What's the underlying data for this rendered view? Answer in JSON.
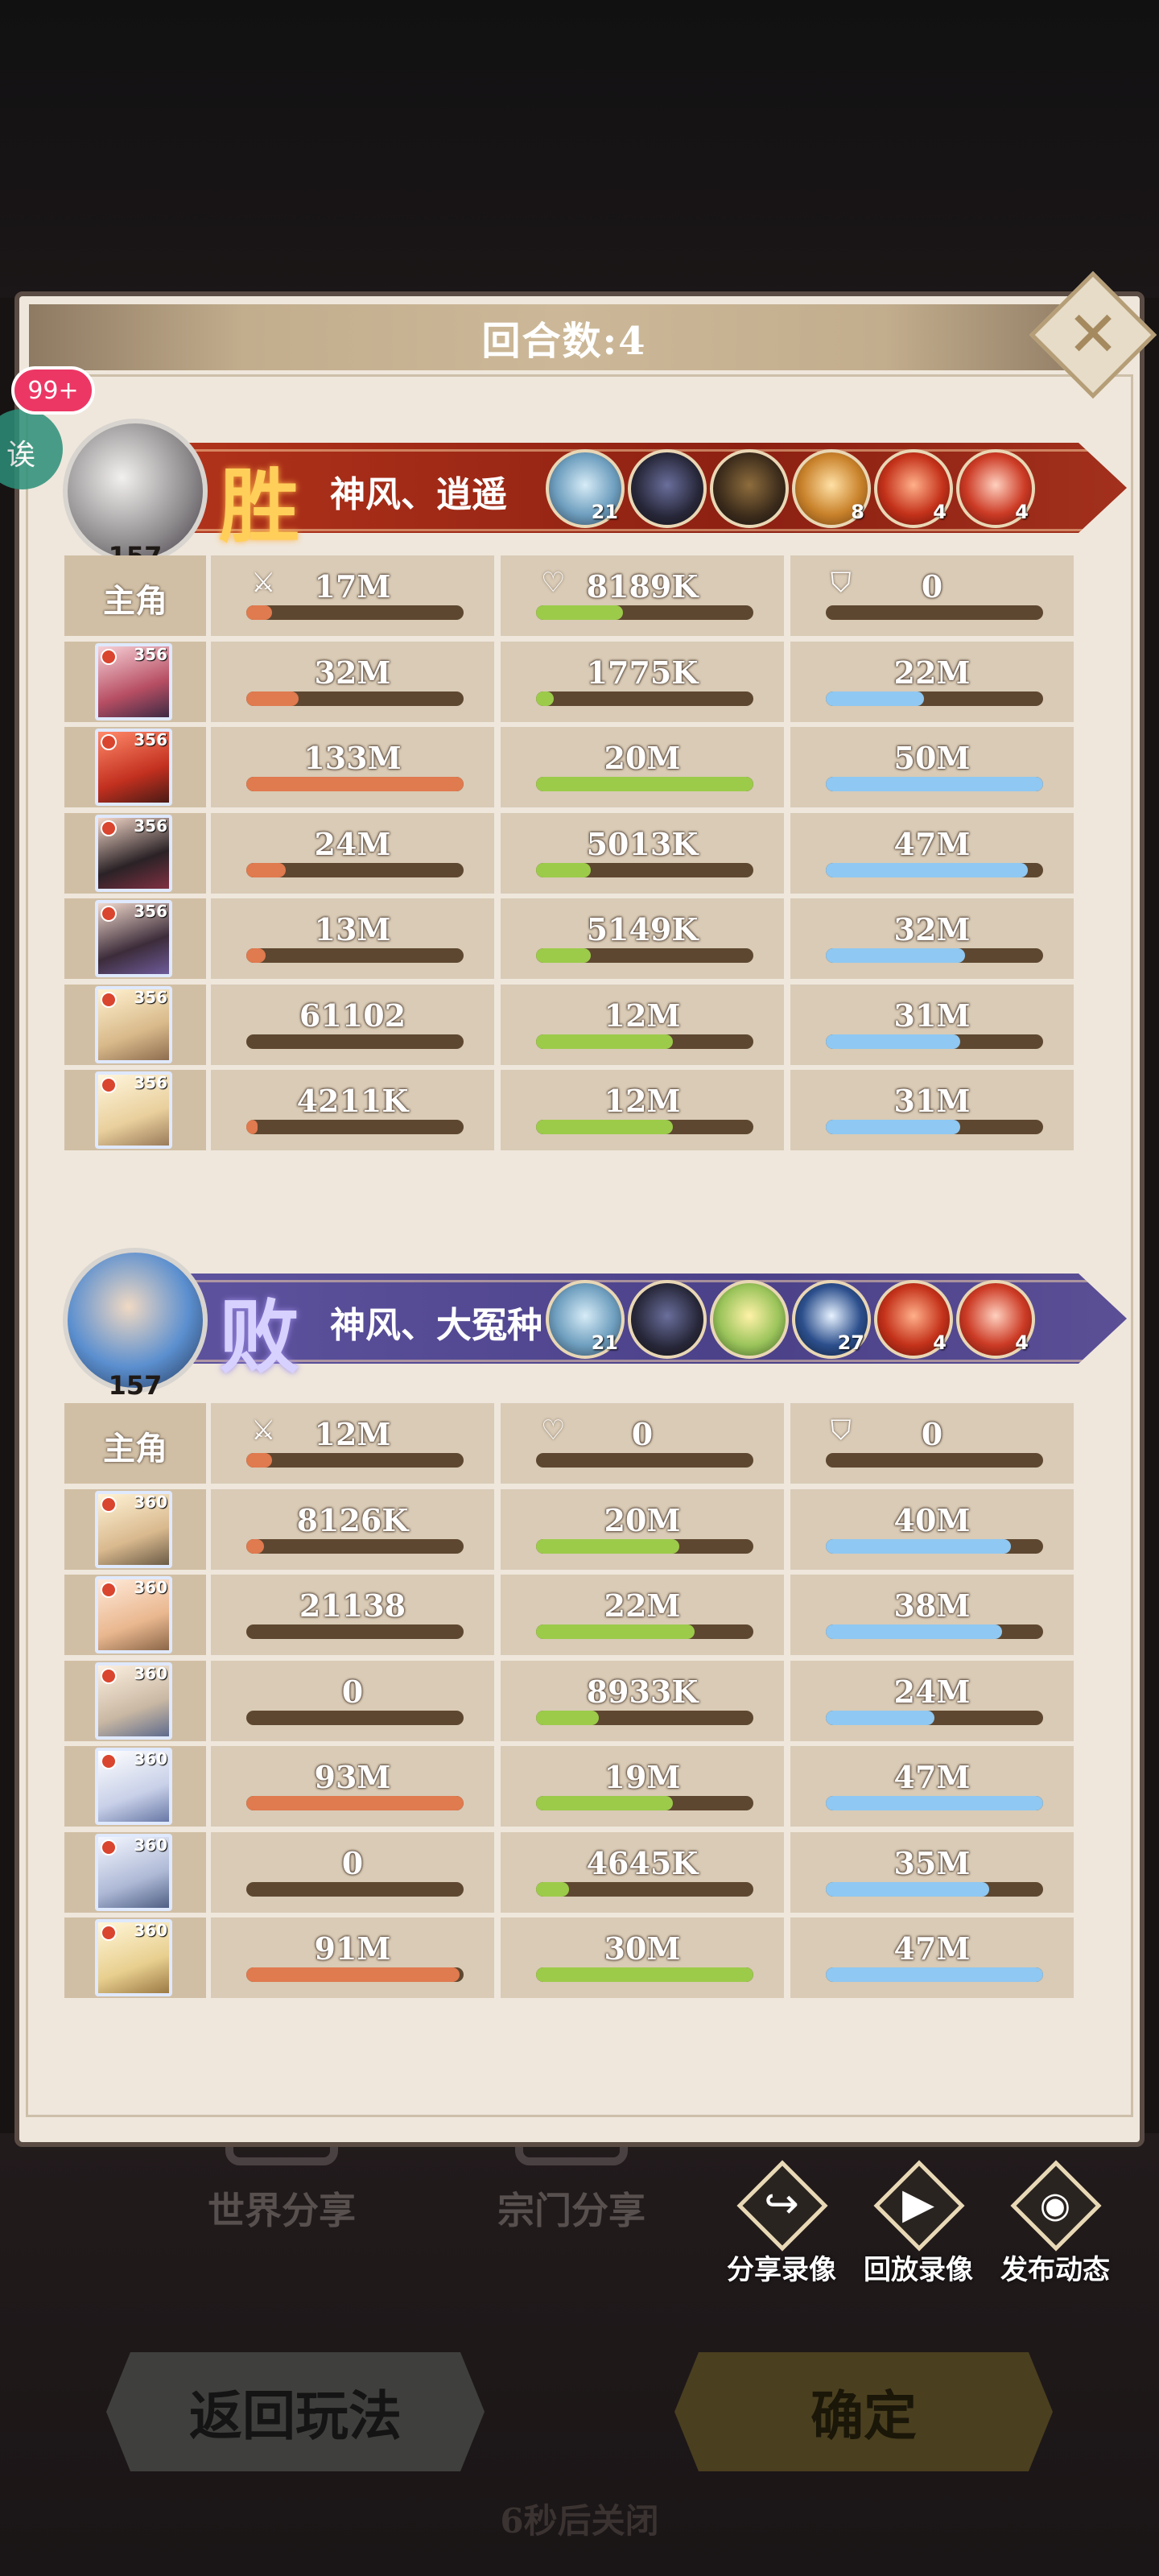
{
  "title": "回合数:4",
  "notification_badge": "99+",
  "side_bubble_char": "诶",
  "winner": {
    "result": "胜",
    "team_name": "神风、逍遥",
    "level": "157",
    "pets": [
      {
        "icon": "ice-wing-icon",
        "count": "21"
      },
      {
        "icon": "dark-beast-icon",
        "count": ""
      },
      {
        "icon": "beast-icon",
        "count": ""
      },
      {
        "icon": "wing-emblem-icon",
        "count": "8"
      },
      {
        "icon": "fire-icon",
        "count": "4"
      },
      {
        "icon": "flame-icon",
        "count": "4"
      }
    ],
    "leader": {
      "label": "主角",
      "atk": "17M",
      "heal": "8189K",
      "def": "0",
      "atk_pct": 0.12,
      "heal_pct": 0.4,
      "def_pct": 0.0
    },
    "heroes": [
      {
        "level": "356",
        "atk": "32M",
        "heal": "1775K",
        "def": "22M",
        "atk_pct": 0.24,
        "heal_pct": 0.08,
        "def_pct": 0.45
      },
      {
        "level": "356",
        "atk": "133M",
        "heal": "20M",
        "def": "50M",
        "atk_pct": 1.0,
        "heal_pct": 1.0,
        "def_pct": 1.0
      },
      {
        "level": "356",
        "atk": "24M",
        "heal": "5013K",
        "def": "47M",
        "atk_pct": 0.18,
        "heal_pct": 0.25,
        "def_pct": 0.93
      },
      {
        "level": "356",
        "atk": "13M",
        "heal": "5149K",
        "def": "32M",
        "atk_pct": 0.09,
        "heal_pct": 0.25,
        "def_pct": 0.64
      },
      {
        "level": "356",
        "atk": "61102",
        "heal": "12M",
        "def": "31M",
        "atk_pct": 0.0,
        "heal_pct": 0.63,
        "def_pct": 0.62
      },
      {
        "level": "356",
        "atk": "4211K",
        "heal": "12M",
        "def": "31M",
        "atk_pct": 0.03,
        "heal_pct": 0.63,
        "def_pct": 0.62
      }
    ]
  },
  "loser": {
    "result": "败",
    "team_name": "神风、大冤种",
    "level": "157",
    "pets": [
      {
        "icon": "ice-wing-icon",
        "count": "21"
      },
      {
        "icon": "dark-beast-icon",
        "count": ""
      },
      {
        "icon": "crystal-plant-icon",
        "count": ""
      },
      {
        "icon": "crest-icon",
        "count": "27"
      },
      {
        "icon": "fire-icon",
        "count": "4"
      },
      {
        "icon": "flame-icon",
        "count": "4"
      }
    ],
    "leader": {
      "label": "主角",
      "atk": "12M",
      "heal": "0",
      "def": "0",
      "atk_pct": 0.12,
      "heal_pct": 0.0,
      "def_pct": 0.0
    },
    "heroes": [
      {
        "level": "360",
        "atk": "8126K",
        "heal": "20M",
        "def": "40M",
        "atk_pct": 0.08,
        "heal_pct": 0.66,
        "def_pct": 0.85
      },
      {
        "level": "360",
        "atk": "21138",
        "heal": "22M",
        "def": "38M",
        "atk_pct": 0.0,
        "heal_pct": 0.73,
        "def_pct": 0.81
      },
      {
        "level": "360",
        "atk": "0",
        "heal": "8933K",
        "def": "24M",
        "atk_pct": 0.0,
        "heal_pct": 0.29,
        "def_pct": 0.5
      },
      {
        "level": "360",
        "atk": "93M",
        "heal": "19M",
        "def": "47M",
        "atk_pct": 1.0,
        "heal_pct": 0.63,
        "def_pct": 1.0
      },
      {
        "level": "360",
        "atk": "0",
        "heal": "4645K",
        "def": "35M",
        "atk_pct": 0.0,
        "heal_pct": 0.15,
        "def_pct": 0.75
      },
      {
        "level": "360",
        "atk": "91M",
        "heal": "30M",
        "def": "47M",
        "atk_pct": 0.98,
        "heal_pct": 1.0,
        "def_pct": 1.0
      }
    ]
  },
  "background_labels": {
    "world_share": "世界分享",
    "sect_share": "宗门分享"
  },
  "actions": {
    "share_replay": "分享录像",
    "play_replay": "回放录像",
    "post_update": "发布动态"
  },
  "buttons": {
    "back": "返回玩法",
    "confirm": "确定"
  },
  "countdown": "6秒后关闭",
  "colors": {
    "attack_bar": "#e07a4f",
    "heal_bar": "#9ccb4a",
    "defense_bar": "#8fc8f2",
    "win_banner": "#9e2a16",
    "lose_banner": "#5548a0"
  }
}
